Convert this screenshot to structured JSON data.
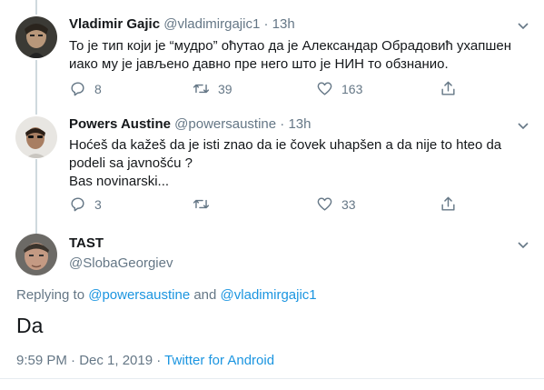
{
  "tweets": [
    {
      "name": "Vladimir Gajic",
      "handle": "@vladimirgajic1",
      "separator": "·",
      "time": "13h",
      "lines": [
        "То је тип који је “мудро” оћутао да је  Александар Обрадовић ухапшен",
        "иако му је јављено давно пре него што је НИН то обзнанио."
      ],
      "replies": "8",
      "retweets": "39",
      "likes": "163"
    },
    {
      "name": "Powers Austine",
      "handle": "@powersaustine",
      "separator": "·",
      "time": "13h",
      "lines": [
        "Hoćeš da kažeš da je isti znao da ie čovek uhapšen a da nije to hteo da",
        "podeli sa javnošću ?",
        "Bas novinarski..."
      ],
      "replies": "3",
      "retweets": "",
      "likes": "33"
    }
  ],
  "main_tweet": {
    "name": "TAST",
    "handle": "@SlobaGeorgiev",
    "replying_prefix": "Replying to",
    "replying_user1": "@powersaustine",
    "replying_and": "and",
    "replying_user2": "@vladimirgajic1",
    "text": "Da",
    "timestamp": "9:59 PM · Dec 1, 2019 ·",
    "source": "Twitter for Android"
  },
  "icons": {
    "reply": "reply-icon",
    "retweet": "retweet-icon",
    "like": "heart-icon",
    "share": "share-icon",
    "more": "chevron-down-icon"
  },
  "colors": {
    "link": "#1b95e0",
    "secondary_text": "#657786",
    "thread_line": "#cfd9de"
  }
}
